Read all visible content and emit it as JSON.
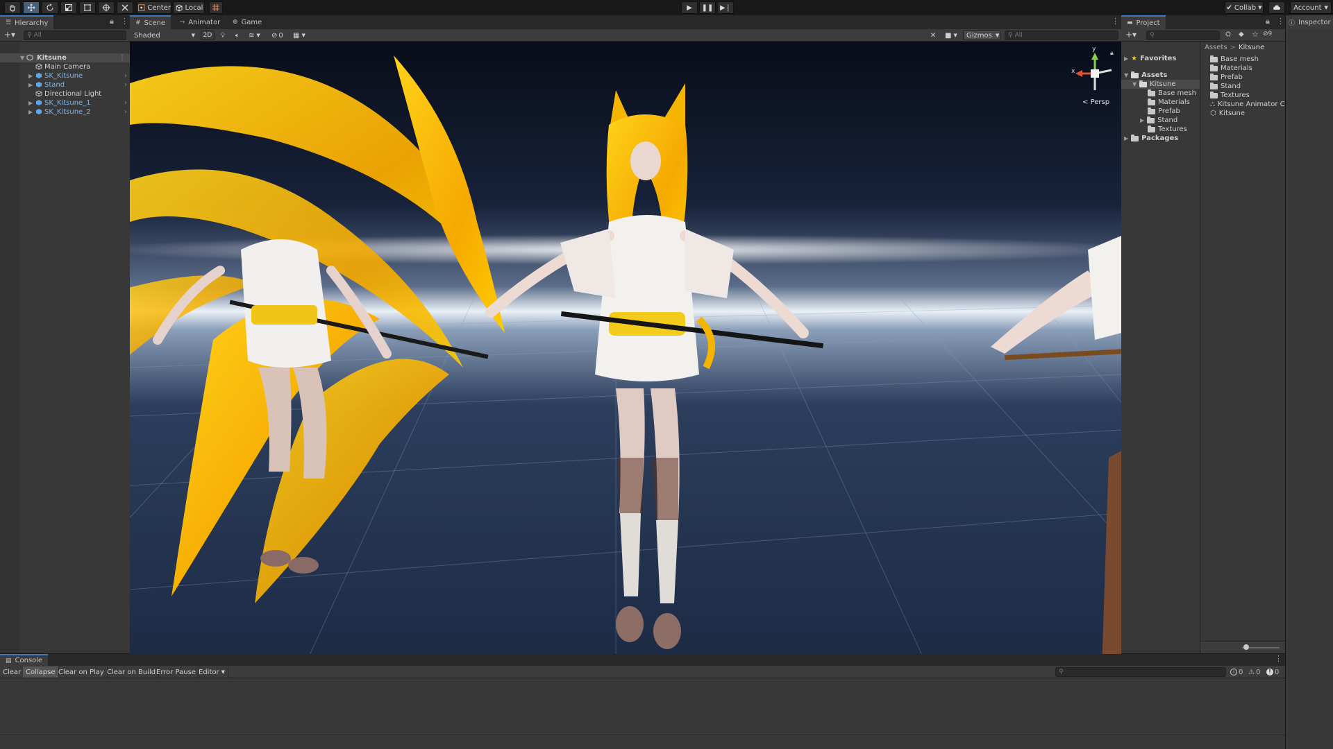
{
  "toolbar": {
    "pivot_label": "Center",
    "space_label": "Local",
    "collab_label": "Collab",
    "account_label": "Account"
  },
  "hierarchy": {
    "tab_label": "Hierarchy",
    "search_placeholder": "All",
    "items": [
      {
        "label": "Kitsune"
      },
      {
        "label": "Main Camera"
      },
      {
        "label": "SK_Kitsune"
      },
      {
        "label": "Stand"
      },
      {
        "label": "Directional Light"
      },
      {
        "label": "SK_Kitsune_1"
      },
      {
        "label": "SK_Kitsune_2"
      }
    ]
  },
  "scene": {
    "tabs": [
      {
        "label": "Scene"
      },
      {
        "label": "Animator"
      },
      {
        "label": "Game"
      }
    ],
    "shading_mode": "Shaded",
    "mode_2d_label": "2D",
    "hidden_count": "0",
    "gizmos_label": "Gizmos",
    "search_placeholder": "All",
    "projection_label": "Persp",
    "gizmo_axes": {
      "x": "x",
      "y": "y"
    }
  },
  "project": {
    "tab_label": "Project",
    "hidden_count": "9",
    "favorites_label": "Favorites",
    "assets_label": "Assets",
    "packages_label": "Packages",
    "tree_items": [
      {
        "label": "Kitsune"
      },
      {
        "label": "Base mesh"
      },
      {
        "label": "Materials"
      },
      {
        "label": "Prefab"
      },
      {
        "label": "Stand"
      },
      {
        "label": "Textures"
      }
    ],
    "breadcrumb": {
      "root": "Assets",
      "separator": ">",
      "current": "Kitsune"
    },
    "files": [
      {
        "label": "Base mesh"
      },
      {
        "label": "Materials"
      },
      {
        "label": "Prefab"
      },
      {
        "label": "Stand"
      },
      {
        "label": "Textures"
      },
      {
        "label": "Kitsune Animator Co"
      },
      {
        "label": "Kitsune"
      }
    ]
  },
  "inspector": {
    "tab_label": "Inspector"
  },
  "console": {
    "tab_label": "Console",
    "buttons": [
      {
        "label": "Clear"
      },
      {
        "label": "Collapse"
      },
      {
        "label": "Clear on Play"
      },
      {
        "label": "Clear on Build"
      },
      {
        "label": "Error Pause"
      },
      {
        "label": "Editor"
      }
    ],
    "info_count": "0",
    "warning_count": "0",
    "error_count": "0"
  },
  "colors": {
    "accent": "#3a79bb",
    "prefab_text": "#7cb4ef",
    "panel_bg": "#383838",
    "tab_bg": "#282828"
  }
}
